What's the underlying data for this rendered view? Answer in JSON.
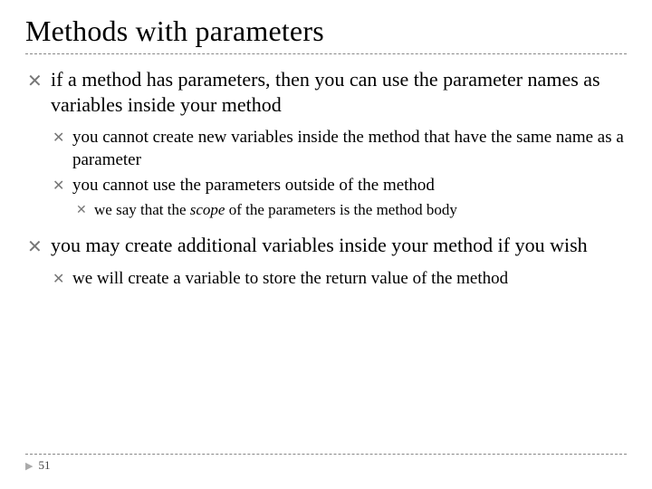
{
  "title": "Methods with parameters",
  "bullets": {
    "b1": "if a method has parameters, then you can use the parameter names as variables inside your method",
    "b1a": "you cannot create new variables inside the method that have the same name as a parameter",
    "b1b": "you cannot use the parameters outside of the method",
    "b1b1_pre": "we say that the ",
    "b1b1_em": "scope",
    "b1b1_post": " of the parameters is the method body",
    "b2": "you may create additional variables inside your method if you wish",
    "b2a": "we will create a variable to store the return value of the method"
  },
  "page_number": "51"
}
